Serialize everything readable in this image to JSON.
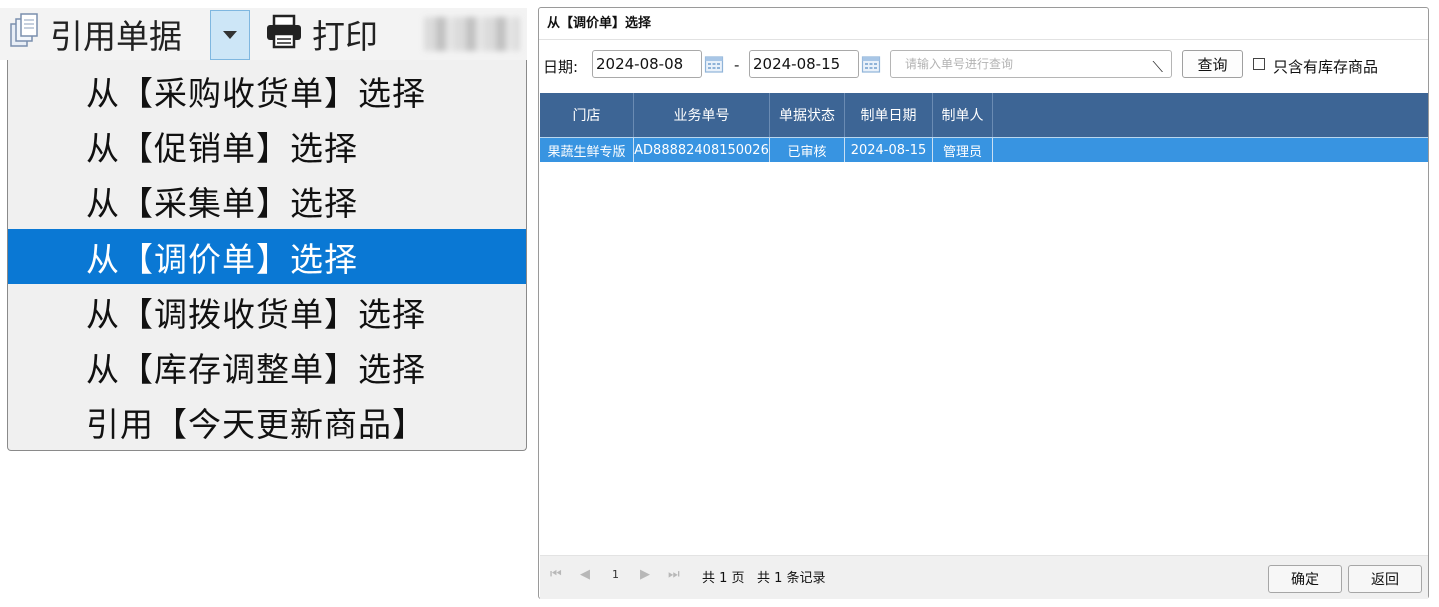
{
  "toolbar": {
    "reference_label": "引用单据",
    "print_label": "打印"
  },
  "menu": {
    "items": [
      {
        "label": "从【采购收货单】选择",
        "active": false
      },
      {
        "label": "从【促销单】选择",
        "active": false
      },
      {
        "label": "从【采集单】选择",
        "active": false
      },
      {
        "label": "从【调价单】选择",
        "active": true
      },
      {
        "label": "从【调拨收货单】选择",
        "active": false
      },
      {
        "label": "从【库存调整单】选择",
        "active": false
      },
      {
        "label": "引用【今天更新商品】",
        "active": false
      }
    ]
  },
  "dialog": {
    "title": "从【调价单】选择",
    "date_label": "日期:",
    "date_from": "2024-08-08",
    "date_separator": "-",
    "date_to": "2024-08-15",
    "search_placeholder": "请输入单号进行查询",
    "query_button": "查询",
    "stock_only_label": "只含有库存商品",
    "stock_only_checked": false,
    "columns": [
      "门店",
      "业务单号",
      "单据状态",
      "制单日期",
      "制单人"
    ],
    "rows": [
      [
        "果蔬生鲜专版",
        "AD88882408150026",
        "已审核",
        "2024-08-15",
        "管理员"
      ]
    ],
    "pagination": {
      "current_page": "1",
      "total_pages_text": "共 1 页",
      "total_records_text": "共 1 条记录"
    },
    "ok_button": "确定",
    "back_button": "返回"
  },
  "colors": {
    "menu_highlight": "#0a78d4",
    "grid_header": "#3d6595",
    "grid_row_selected": "#3894e1"
  }
}
